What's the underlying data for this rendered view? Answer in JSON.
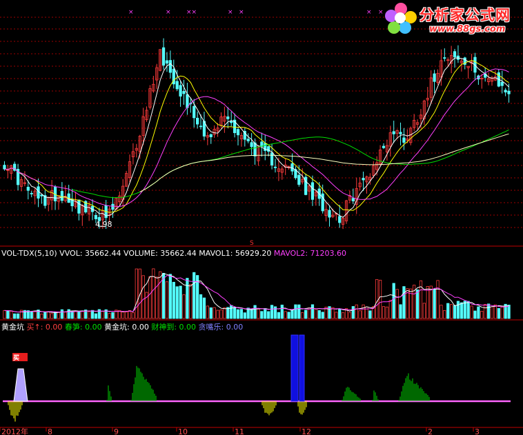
{
  "colors": {
    "up": "#ff3c3c",
    "down": "#54ffff",
    "ma5": "#ffffff",
    "ma10": "#ffff00",
    "ma20": "#ff40ff",
    "ma60": "#00e000",
    "ma120": "#ffffc0",
    "grid": "#a00000",
    "axis": "#c00000",
    "baseline": "#ff66ff"
  },
  "price_panel": {
    "low_label": "4.98",
    "marker_symbol": "S",
    "top_markers": [
      "×",
      "×",
      "××",
      "×",
      "×",
      "×",
      "×"
    ]
  },
  "volume_panel": {
    "items": [
      {
        "text": "VOL-TDX(5,10)",
        "color": "#ffffff"
      },
      {
        "text": " VVOL: 35662.44",
        "color": "#ffffff"
      },
      {
        "text": "  VOLUME: 35662.44",
        "color": "#ffffff"
      },
      {
        "text": "  MAVOL1: 56929.20",
        "color": "#ffffff"
      },
      {
        "text": "  MAVOL2: 71203.60",
        "color": "#ff40ff"
      }
    ]
  },
  "indicator_panel": {
    "items": [
      {
        "text": "黄金坑",
        "color": "#ffffff"
      },
      {
        "text": "  买",
        "color": "#ff4040"
      },
      {
        "text": "↑",
        "color": "#ff4040"
      },
      {
        "text": ": 0.00",
        "color": "#ff4040"
      },
      {
        "text": "  春笋: 0.00",
        "color": "#00e000"
      },
      {
        "text": "  黄金坑: 0.00",
        "color": "#ffffff"
      },
      {
        "text": "  财神到: 0.00",
        "color": "#00e000"
      },
      {
        "text": "  贪嘴乐: 0.00",
        "color": "#8080ff"
      }
    ],
    "buy_signal_label": "买"
  },
  "x_axis_labels": [
    "2012年",
    "8",
    "9",
    "10",
    "11",
    "12",
    "2",
    "3"
  ],
  "logo": {
    "title": "分析家公式网",
    "url": "www.88gs.com"
  },
  "chart_data": [
    {
      "type": "candlestick",
      "title": "",
      "moving_averages": [
        "MA5",
        "MA10",
        "MA20",
        "MA60",
        "MA120"
      ],
      "annotations": [
        {
          "text": "4.98",
          "meaning": "period low"
        }
      ],
      "approx_close_path": [
        6.4,
        6.0,
        5.6,
        5.4,
        5.6,
        5.5,
        5.2,
        5.1,
        4.98,
        5.6,
        6.6,
        7.8,
        9.2,
        8.6,
        8.0,
        7.4,
        7.0,
        7.6,
        7.2,
        6.8,
        6.6,
        6.4,
        6.2,
        5.8,
        5.5,
        5.2,
        5.0,
        5.6,
        6.0,
        6.6,
        7.2,
        7.0,
        7.6,
        8.4,
        9.2,
        9.0,
        8.8,
        8.6,
        8.4,
        8.2
      ]
    },
    {
      "type": "bar",
      "title": "VOL-TDX(5,10)",
      "series": [
        {
          "name": "VVOL",
          "values": [
            35662.44
          ]
        },
        {
          "name": "VOLUME",
          "values": [
            35662.44
          ]
        },
        {
          "name": "MAVOL1",
          "values": [
            56929.2
          ]
        },
        {
          "name": "MAVOL2",
          "values": [
            71203.6
          ]
        }
      ]
    },
    {
      "type": "bar",
      "title": "黄金坑",
      "series": [
        {
          "name": "买↑",
          "values": [
            0.0
          ]
        },
        {
          "name": "春笋",
          "values": [
            0.0
          ]
        },
        {
          "name": "黄金坑",
          "values": [
            0.0
          ]
        },
        {
          "name": "财神到",
          "values": [
            0.0
          ]
        },
        {
          "name": "贪嘴乐",
          "values": [
            0.0
          ]
        }
      ]
    }
  ]
}
